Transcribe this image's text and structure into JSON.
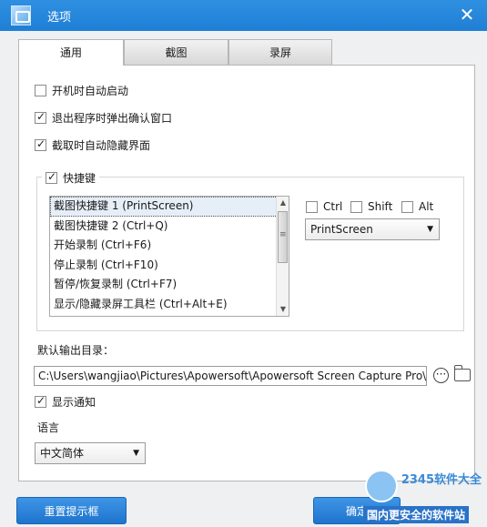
{
  "window": {
    "title": "选项"
  },
  "tabs": [
    {
      "label": "通用"
    },
    {
      "label": "截图"
    },
    {
      "label": "录屏"
    }
  ],
  "general": {
    "startup": {
      "label": "开机时自动启动",
      "checked": false
    },
    "exit_confirm": {
      "label": "退出程序时弹出确认窗口",
      "checked": true
    },
    "auto_hide": {
      "label": "截取时自动隐藏界面",
      "checked": true
    },
    "hotkeys": {
      "label": "快捷键",
      "checked": true,
      "items": [
        "截图快捷键 1 (PrintScreen)",
        "截图快捷键 2 (Ctrl+Q)",
        "开始录制 (Ctrl+F6)",
        "停止录制 (Ctrl+F10)",
        "暂停/恢复录制 (Ctrl+F7)",
        "显示/隐藏录屏工具栏 (Ctrl+Alt+E)"
      ],
      "ctrl": {
        "label": "Ctrl",
        "checked": false
      },
      "shift": {
        "label": "Shift",
        "checked": false
      },
      "alt": {
        "label": "Alt",
        "checked": false
      },
      "key_select": "PrintScreen"
    },
    "output_dir_label": "默认输出目录：",
    "output_dir": "C:\\Users\\wangjiao\\Pictures\\Apowersoft\\Apowersoft Screen Capture Pro\\",
    "show_notify": {
      "label": "显示通知",
      "checked": true
    },
    "language_label": "语言",
    "language": "中文简体"
  },
  "footer": {
    "reset_label": "重置提示框",
    "ok_label": "确定"
  },
  "watermark": {
    "brand": "2345软件大全",
    "tag": "国内更安全的软件站"
  },
  "colors": {
    "title_bar": "#1f7fd6",
    "button": "#2a82d8"
  }
}
